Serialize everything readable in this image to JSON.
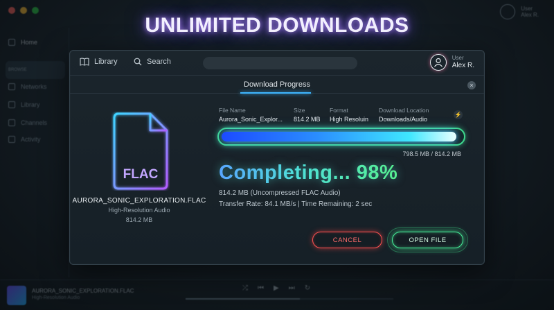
{
  "headline": "UNLIMITED DOWNLOADS",
  "background": {
    "user_label": "User",
    "user_name": "Alex R.",
    "sidebar": [
      {
        "label": "Home",
        "icon": "home-icon"
      },
      {
        "label": "Networks",
        "icon": "network-icon"
      },
      {
        "label": "Library",
        "icon": "library-icon"
      },
      {
        "label": "Channels",
        "icon": "channels-icon"
      },
      {
        "label": "Activity",
        "icon": "activity-icon"
      }
    ],
    "section_label": "BROWSE",
    "player_title": "AURORA_SONIC_EXPLORATION.FLAC",
    "player_subtitle": "High-Resolution Audio"
  },
  "topbar": {
    "library_label": "Library",
    "search_label": "Search",
    "user_label": "User",
    "user_name": "Alex R."
  },
  "dialog": {
    "tab_title": "Download Progress",
    "close_glyph": "×"
  },
  "file": {
    "badge": "FLAC",
    "name": "AURORA_SONIC_EXPLORATION.FLAC",
    "type": "High-Resolution Audio",
    "size": "814.2 MB"
  },
  "meta": {
    "file_name_label": "File Name",
    "file_name_value": "Aurora_Sonic_Explor...",
    "size_label": "Size",
    "size_value": "814.2 MB",
    "format_label": "Format",
    "format_value": "High Resoluin",
    "location_label": "Download Location",
    "location_value": "Downloads/Audio"
  },
  "progress": {
    "fraction": 0.98,
    "transferred_text": "798.5 MB / 814.2 MB",
    "status": "Completing... 98%",
    "detail_line1": "814.2 MB (Uncompressed FLAC Audio)",
    "detail_line2": "Transfer Rate: 84.1 MB/s  |  Time Remaining: 2 sec"
  },
  "buttons": {
    "cancel": "CANCEL",
    "open": "OPEN FILE"
  },
  "colors": {
    "accent_blue": "#3fb6ff",
    "accent_green": "#47f09a",
    "danger_red": "#ff5252",
    "headline_glow": "#9a6bff"
  }
}
